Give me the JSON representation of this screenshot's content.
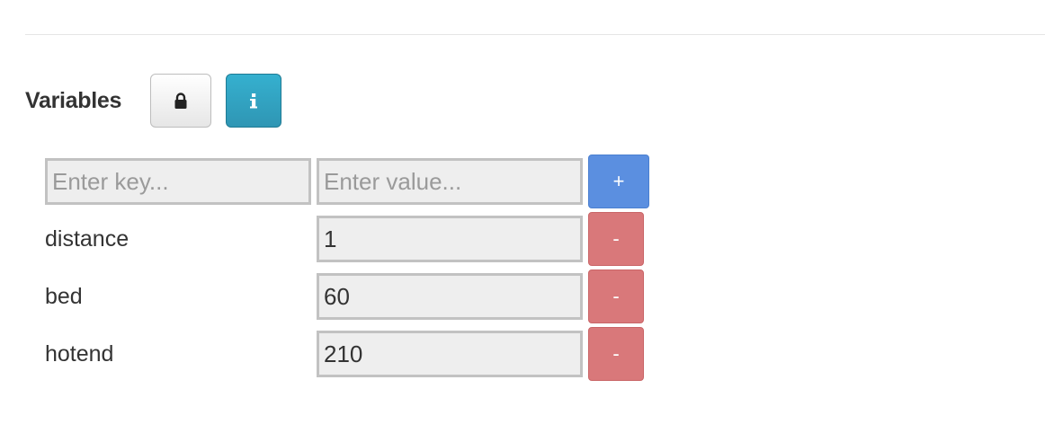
{
  "header": {
    "title": "Variables",
    "lock_icon": "lock-icon",
    "info_icon": "info-icon",
    "info_color": "#31a6c7"
  },
  "new_entry": {
    "key_placeholder": "Enter key...",
    "value_placeholder": "Enter value...",
    "add_label": "+",
    "add_color": "#5b8fe0"
  },
  "variables": [
    {
      "key": "distance",
      "value": "1",
      "remove_label": "-"
    },
    {
      "key": "bed",
      "value": "60",
      "remove_label": "-"
    },
    {
      "key": "hotend",
      "value": "210",
      "remove_label": "-"
    }
  ],
  "colors": {
    "remove": "#d9787a"
  }
}
